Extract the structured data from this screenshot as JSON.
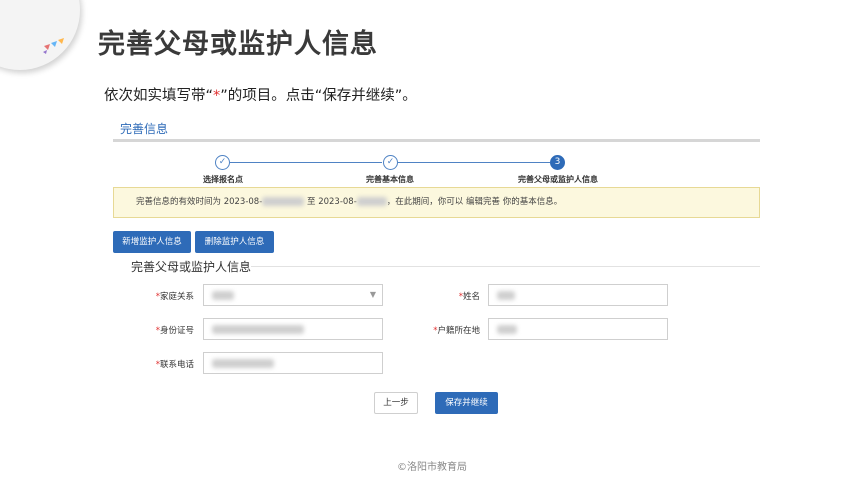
{
  "slide": {
    "title": "完善父母或监护人信息",
    "instruction_before": "依次如实填写带“",
    "instruction_star": "*",
    "instruction_after": "”的项目。点击“保存并继续”。"
  },
  "card": {
    "title": "完善信息"
  },
  "steps": [
    {
      "label": "选择报名点",
      "marker": "✓",
      "state": "done"
    },
    {
      "label": "完善基本信息",
      "marker": "✓",
      "state": "done"
    },
    {
      "label": "完善父母或监护人信息",
      "marker": "3",
      "state": "active"
    }
  ],
  "notice": {
    "prefix": "完善信息的有效时间为 2023-08-",
    "middle": "至 2023-08-",
    "suffix": "，在此期间，你可以 编辑完善 你的基本信息。"
  },
  "buttons": {
    "add_guardian": "新增监护人信息",
    "delete_guardian": "删除监护人信息",
    "prev": "上一步",
    "save_continue": "保存并继续"
  },
  "form": {
    "section_title": "完善父母或监护人信息",
    "required_mark": "*",
    "fields": {
      "relation": "家庭关系",
      "name": "姓名",
      "id_number": "身份证号",
      "hukou": "户籍所在地",
      "phone": "联系电话"
    }
  },
  "footer": {
    "text": "©洛阳市教育局"
  },
  "colors": {
    "accent": "#2e6bb8",
    "notice_bg": "#fcf8de",
    "required": "#e03030"
  }
}
